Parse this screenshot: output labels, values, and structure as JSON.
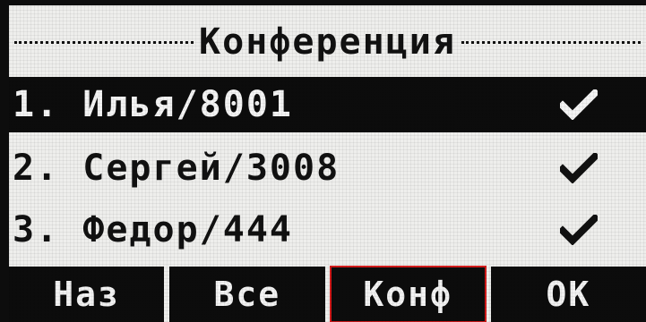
{
  "screen": {
    "title": "Конференция"
  },
  "participants": [
    {
      "label": "1. Илья/8001",
      "checked": true,
      "selected": true
    },
    {
      "label": "2. Сергей/3008",
      "checked": true,
      "selected": false
    },
    {
      "label": "3. Федор/444",
      "checked": true,
      "selected": false
    }
  ],
  "softkeys": [
    {
      "label": "Наз"
    },
    {
      "label": "Все"
    },
    {
      "label": "Конф",
      "highlighted": true
    },
    {
      "label": "OK"
    }
  ],
  "icons": {
    "check": "check-icon"
  },
  "colors": {
    "lcd_background": "#eeeeec",
    "lcd_foreground": "#0c0c0c",
    "highlight_outline": "#d21b1b"
  }
}
